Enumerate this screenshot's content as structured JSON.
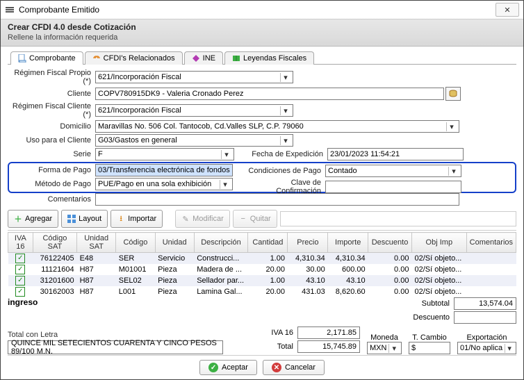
{
  "window": {
    "title": "Comprobante Emitido"
  },
  "subheader": {
    "title": "Crear CFDI 4.0 desde Cotización",
    "subtitle": "Rellene la información requerida"
  },
  "tabs": {
    "comprobante": "Comprobante",
    "cfdis": "CFDI's Relacionados",
    "ine": "INE",
    "leyendas": "Leyendas Fiscales"
  },
  "labels": {
    "regimenPropio": "Régimen Fiscal Propio (*)",
    "cliente": "Cliente",
    "regimenCliente": "Régimen Fiscal Cliente (*)",
    "domicilio": "Domicilio",
    "usoCliente": "Uso para el Cliente",
    "serie": "Serie",
    "fechaExp": "Fecha de Expedición",
    "formaPago": "Forma de Pago",
    "condPago": "Condiciones de Pago",
    "metodoPago": "Método de Pago",
    "claveConf": "Clave de Confirmación",
    "comentarios": "Comentarios"
  },
  "values": {
    "regimenPropio": "621/Incorporación Fiscal",
    "cliente": "COPV780915DK9 - Valeria Cronado Perez",
    "regimenCliente": "621/Incorporación Fiscal",
    "domicilio": "Maravillas No. 506 Col. Tantocob, Cd.Valles SLP, C.P. 79060",
    "usoCliente": "G03/Gastos en general",
    "serie": "F",
    "fechaExp": "23/01/2023 11:54:21",
    "formaPago": "03/Transferencia electrónica de fondos",
    "condPago": "Contado",
    "metodoPago": "PUE/Pago en una sola exhibición",
    "claveConf": "",
    "comentarios": ""
  },
  "toolbar": {
    "agregar": "Agregar",
    "layout": "Layout",
    "importar": "Importar",
    "modificar": "Modificar",
    "quitar": "Quitar"
  },
  "gridHeaders": {
    "iva": "IVA 16",
    "codigoSat": "Código SAT",
    "unidadSat": "Unidad SAT",
    "codigo": "Código",
    "unidad": "Unidad",
    "descripcion": "Descripción",
    "cantidad": "Cantidad",
    "precio": "Precio",
    "importe": "Importe",
    "descuento": "Descuento",
    "objImp": "Obj Imp",
    "comentarios": "Comentarios"
  },
  "gridRows": [
    {
      "codigoSat": "76122405",
      "unidadSat": "E48",
      "codigo": "SER",
      "unidad": "Servicio",
      "descripcion": "Construcci...",
      "cantidad": "1.00",
      "precio": "4,310.34",
      "importe": "4,310.34",
      "descuento": "0.00",
      "objImp": "02/Sí objeto..."
    },
    {
      "codigoSat": "11121604",
      "unidadSat": "H87",
      "codigo": "M01001",
      "unidad": "Pieza",
      "descripcion": "Madera de ...",
      "cantidad": "20.00",
      "precio": "30.00",
      "importe": "600.00",
      "descuento": "0.00",
      "objImp": "02/Sí objeto..."
    },
    {
      "codigoSat": "31201600",
      "unidadSat": "H87",
      "codigo": "SEL02",
      "unidad": "Pieza",
      "descripcion": "Sellador par...",
      "cantidad": "1.00",
      "precio": "43.10",
      "importe": "43.10",
      "descuento": "0.00",
      "objImp": "02/Sí objeto..."
    },
    {
      "codigoSat": "30162003",
      "unidadSat": "H87",
      "codigo": "L001",
      "unidad": "Pieza",
      "descripcion": "Lamina Gal...",
      "cantidad": "20.00",
      "precio": "431.03",
      "importe": "8,620.60",
      "descuento": "0.00",
      "objImp": "02/Sí objeto..."
    }
  ],
  "totals": {
    "ingreso": "ingreso",
    "subtotalLbl": "Subtotal",
    "subtotal": "13,574.04",
    "descuentoLbl": "Descuento",
    "descuento": "",
    "ivaLbl": "IVA 16",
    "iva": "2,171.85",
    "totalLbl": "Total",
    "total": "15,745.89",
    "letraLbl": "Total con Letra",
    "letra": "QUINCE MIL SETECIENTOS CUARENTA Y CINCO PESOS 89/100 M.N.",
    "monedaLbl": "Moneda",
    "moneda": "MXN",
    "tcambioLbl": "T. Cambio",
    "tcambio": "$",
    "exportLbl": "Exportación",
    "export": "01/No aplica"
  },
  "footer": {
    "aceptar": "Aceptar",
    "cancelar": "Cancelar"
  }
}
